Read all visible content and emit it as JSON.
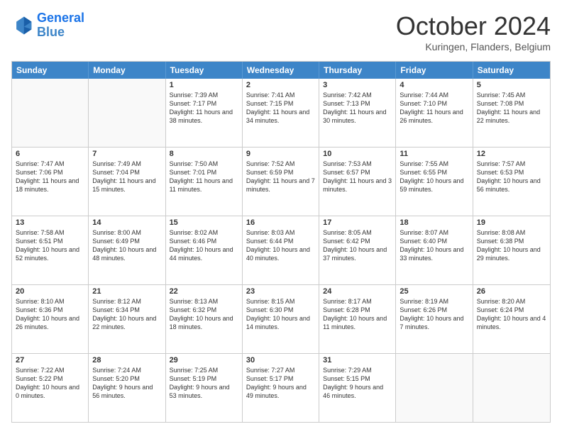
{
  "header": {
    "logo_line1": "General",
    "logo_line2": "Blue",
    "month_title": "October 2024",
    "location": "Kuringen, Flanders, Belgium"
  },
  "day_headers": [
    "Sunday",
    "Monday",
    "Tuesday",
    "Wednesday",
    "Thursday",
    "Friday",
    "Saturday"
  ],
  "weeks": [
    [
      {
        "date": "",
        "empty": true
      },
      {
        "date": "",
        "empty": true
      },
      {
        "date": "1",
        "sunrise": "Sunrise: 7:39 AM",
        "sunset": "Sunset: 7:17 PM",
        "daylight": "Daylight: 11 hours and 38 minutes."
      },
      {
        "date": "2",
        "sunrise": "Sunrise: 7:41 AM",
        "sunset": "Sunset: 7:15 PM",
        "daylight": "Daylight: 11 hours and 34 minutes."
      },
      {
        "date": "3",
        "sunrise": "Sunrise: 7:42 AM",
        "sunset": "Sunset: 7:13 PM",
        "daylight": "Daylight: 11 hours and 30 minutes."
      },
      {
        "date": "4",
        "sunrise": "Sunrise: 7:44 AM",
        "sunset": "Sunset: 7:10 PM",
        "daylight": "Daylight: 11 hours and 26 minutes."
      },
      {
        "date": "5",
        "sunrise": "Sunrise: 7:45 AM",
        "sunset": "Sunset: 7:08 PM",
        "daylight": "Daylight: 11 hours and 22 minutes."
      }
    ],
    [
      {
        "date": "6",
        "sunrise": "Sunrise: 7:47 AM",
        "sunset": "Sunset: 7:06 PM",
        "daylight": "Daylight: 11 hours and 18 minutes."
      },
      {
        "date": "7",
        "sunrise": "Sunrise: 7:49 AM",
        "sunset": "Sunset: 7:04 PM",
        "daylight": "Daylight: 11 hours and 15 minutes."
      },
      {
        "date": "8",
        "sunrise": "Sunrise: 7:50 AM",
        "sunset": "Sunset: 7:01 PM",
        "daylight": "Daylight: 11 hours and 11 minutes."
      },
      {
        "date": "9",
        "sunrise": "Sunrise: 7:52 AM",
        "sunset": "Sunset: 6:59 PM",
        "daylight": "Daylight: 11 hours and 7 minutes."
      },
      {
        "date": "10",
        "sunrise": "Sunrise: 7:53 AM",
        "sunset": "Sunset: 6:57 PM",
        "daylight": "Daylight: 11 hours and 3 minutes."
      },
      {
        "date": "11",
        "sunrise": "Sunrise: 7:55 AM",
        "sunset": "Sunset: 6:55 PM",
        "daylight": "Daylight: 10 hours and 59 minutes."
      },
      {
        "date": "12",
        "sunrise": "Sunrise: 7:57 AM",
        "sunset": "Sunset: 6:53 PM",
        "daylight": "Daylight: 10 hours and 56 minutes."
      }
    ],
    [
      {
        "date": "13",
        "sunrise": "Sunrise: 7:58 AM",
        "sunset": "Sunset: 6:51 PM",
        "daylight": "Daylight: 10 hours and 52 minutes."
      },
      {
        "date": "14",
        "sunrise": "Sunrise: 8:00 AM",
        "sunset": "Sunset: 6:49 PM",
        "daylight": "Daylight: 10 hours and 48 minutes."
      },
      {
        "date": "15",
        "sunrise": "Sunrise: 8:02 AM",
        "sunset": "Sunset: 6:46 PM",
        "daylight": "Daylight: 10 hours and 44 minutes."
      },
      {
        "date": "16",
        "sunrise": "Sunrise: 8:03 AM",
        "sunset": "Sunset: 6:44 PM",
        "daylight": "Daylight: 10 hours and 40 minutes."
      },
      {
        "date": "17",
        "sunrise": "Sunrise: 8:05 AM",
        "sunset": "Sunset: 6:42 PM",
        "daylight": "Daylight: 10 hours and 37 minutes."
      },
      {
        "date": "18",
        "sunrise": "Sunrise: 8:07 AM",
        "sunset": "Sunset: 6:40 PM",
        "daylight": "Daylight: 10 hours and 33 minutes."
      },
      {
        "date": "19",
        "sunrise": "Sunrise: 8:08 AM",
        "sunset": "Sunset: 6:38 PM",
        "daylight": "Daylight: 10 hours and 29 minutes."
      }
    ],
    [
      {
        "date": "20",
        "sunrise": "Sunrise: 8:10 AM",
        "sunset": "Sunset: 6:36 PM",
        "daylight": "Daylight: 10 hours and 26 minutes."
      },
      {
        "date": "21",
        "sunrise": "Sunrise: 8:12 AM",
        "sunset": "Sunset: 6:34 PM",
        "daylight": "Daylight: 10 hours and 22 minutes."
      },
      {
        "date": "22",
        "sunrise": "Sunrise: 8:13 AM",
        "sunset": "Sunset: 6:32 PM",
        "daylight": "Daylight: 10 hours and 18 minutes."
      },
      {
        "date": "23",
        "sunrise": "Sunrise: 8:15 AM",
        "sunset": "Sunset: 6:30 PM",
        "daylight": "Daylight: 10 hours and 14 minutes."
      },
      {
        "date": "24",
        "sunrise": "Sunrise: 8:17 AM",
        "sunset": "Sunset: 6:28 PM",
        "daylight": "Daylight: 10 hours and 11 minutes."
      },
      {
        "date": "25",
        "sunrise": "Sunrise: 8:19 AM",
        "sunset": "Sunset: 6:26 PM",
        "daylight": "Daylight: 10 hours and 7 minutes."
      },
      {
        "date": "26",
        "sunrise": "Sunrise: 8:20 AM",
        "sunset": "Sunset: 6:24 PM",
        "daylight": "Daylight: 10 hours and 4 minutes."
      }
    ],
    [
      {
        "date": "27",
        "sunrise": "Sunrise: 7:22 AM",
        "sunset": "Sunset: 5:22 PM",
        "daylight": "Daylight: 10 hours and 0 minutes."
      },
      {
        "date": "28",
        "sunrise": "Sunrise: 7:24 AM",
        "sunset": "Sunset: 5:20 PM",
        "daylight": "Daylight: 9 hours and 56 minutes."
      },
      {
        "date": "29",
        "sunrise": "Sunrise: 7:25 AM",
        "sunset": "Sunset: 5:19 PM",
        "daylight": "Daylight: 9 hours and 53 minutes."
      },
      {
        "date": "30",
        "sunrise": "Sunrise: 7:27 AM",
        "sunset": "Sunset: 5:17 PM",
        "daylight": "Daylight: 9 hours and 49 minutes."
      },
      {
        "date": "31",
        "sunrise": "Sunrise: 7:29 AM",
        "sunset": "Sunset: 5:15 PM",
        "daylight": "Daylight: 9 hours and 46 minutes."
      },
      {
        "date": "",
        "empty": true
      },
      {
        "date": "",
        "empty": true
      }
    ]
  ]
}
